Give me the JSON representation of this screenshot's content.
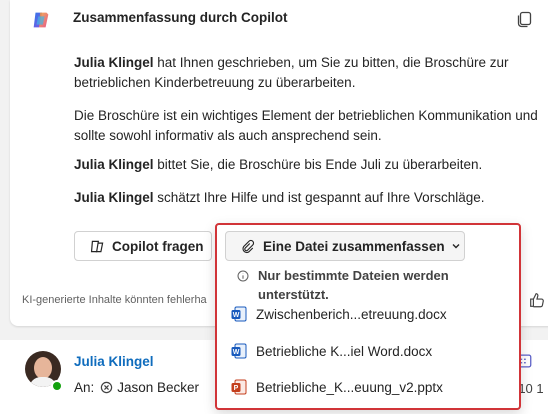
{
  "summary": {
    "title": "Zusammenfassung durch Copilot",
    "paragraphs": [
      {
        "bold": "Julia Klingel",
        "text_line1": " hat Ihnen geschrieben, um Sie zu bitten, die Broschüre zur",
        "text_line2": "betrieblichen Kinderbetreuung zu überarbeiten."
      },
      {
        "line1": "Die Broschüre ist ein wichtiges Element der betrieblichen Kommunikation und",
        "line2": "sollte sowohl informativ als auch ansprechend sein."
      },
      {
        "bold": "Julia Klingel",
        "text": " bittet Sie, die Broschüre bis Ende Juli zu überarbeiten."
      },
      {
        "bold": "Julia Klingel",
        "text": " schätzt Ihre Hilfe und ist gespannt auf Ihre Vorschläge."
      }
    ],
    "ask_copilot_label": "Copilot fragen",
    "summarize_file_label": "Eine Datei zusammenfassen",
    "ai_note": "KI-generierte Inhalte könnten fehlerha"
  },
  "dropdown": {
    "info": "Nur bestimmte Dateien werden unterstützt.",
    "files": [
      {
        "name": "Zwischenberich...etreuung.docx",
        "type": "word"
      },
      {
        "name": "Betriebliche K...iel Word.docx",
        "type": "word"
      },
      {
        "name": "Betriebliche_K...euung_v2.pptx",
        "type": "powerpoint"
      }
    ]
  },
  "message": {
    "sender": "Julia Klingel",
    "to_label": "An:",
    "recipient": "Jason Becker",
    "date_fragment": "-10 1"
  },
  "colors": {
    "accent": "#0f6cbd",
    "highlight_border": "#d13438",
    "word": "#185abd",
    "powerpoint": "#c43e1c",
    "presence": "#13a10e"
  }
}
